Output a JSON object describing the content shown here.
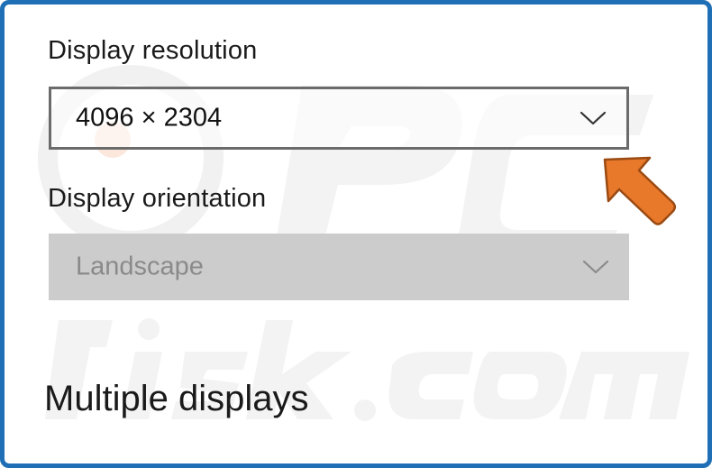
{
  "settings": {
    "resolution_label": "Display resolution",
    "resolution_value": "4096 × 2304",
    "orientation_label": "Display orientation",
    "orientation_value": "Landscape",
    "multiple_displays_heading": "Multiple displays"
  },
  "colors": {
    "frame_border": "#1f6fb6",
    "arrow_fill": "#e8782a",
    "disabled_dropdown_bg": "#cccccc"
  },
  "icons": {
    "dropdown_chevron": "chevron-down-icon",
    "pointer_arrow": "pointer-arrow-icon"
  }
}
